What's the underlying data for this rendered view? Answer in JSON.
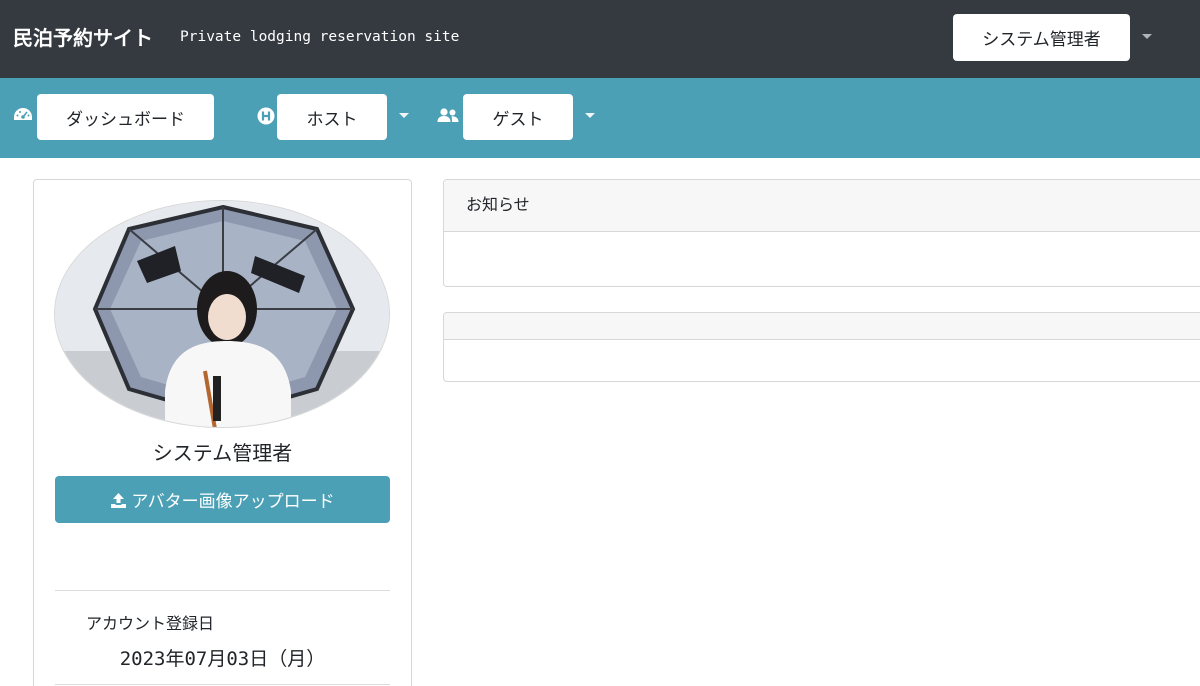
{
  "header": {
    "brand": "民泊予約サイト",
    "tagline": "Private lodging reservation site",
    "user_menu_label": "システム管理者"
  },
  "nav": {
    "items": [
      {
        "label": "ダッシュボード",
        "icon": "dashboard-icon"
      },
      {
        "label": "ホスト",
        "icon": "host-h-icon"
      },
      {
        "label": "ゲスト",
        "icon": "users-icon"
      }
    ]
  },
  "profile": {
    "name": "システム管理者",
    "upload_button": "アバター画像アップロード",
    "registration_label": "アカウント登録日",
    "registration_date": "2023年07月03日（月）"
  },
  "panels": [
    {
      "title": "お知らせ",
      "body": ""
    },
    {
      "title": "",
      "body": ""
    }
  ],
  "colors": {
    "header_bg": "#343a40",
    "nav_bg": "#4ca0b6",
    "accent": "#4ca0b6"
  }
}
